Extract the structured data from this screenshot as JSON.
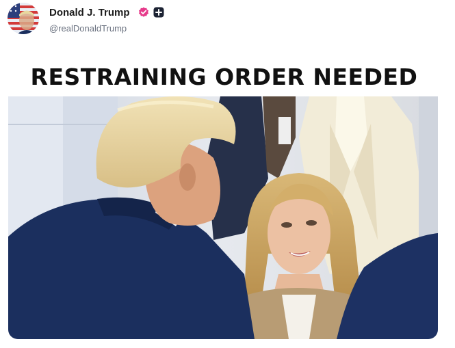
{
  "post": {
    "author_name": "Donald J. Trump",
    "handle": "@realDonaldTrump",
    "headline": "RESTRAINING ORDER NEEDED",
    "icons": {
      "avatar": "flag-portrait-avatar",
      "verified": "verified-check-icon",
      "plus": "plus-badge-icon"
    },
    "colors": {
      "verified_badge": "#e6398a",
      "plus_badge": "#1c2333",
      "suit_navy": "#1b2f5e"
    }
  }
}
